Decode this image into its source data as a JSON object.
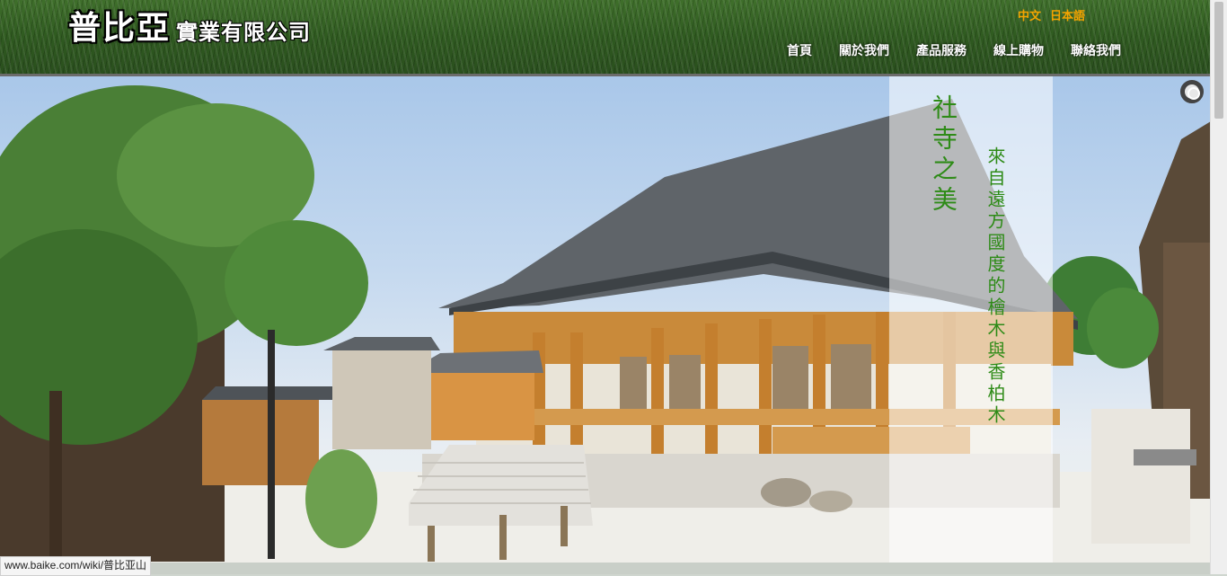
{
  "brand": {
    "name_big": "普比亞",
    "name_small": "實業有限公司"
  },
  "languages": [
    "中文",
    "日本語"
  ],
  "nav": [
    "首頁",
    "關於我們",
    "產品服務",
    "線上購物",
    "聯絡我們"
  ],
  "banner": {
    "title": "社寺之美",
    "subtitle": "來自遠方國度的檜木與香柏木"
  },
  "status_url": "www.baike.com/wiki/普比亚山",
  "icons": {
    "loader": "loading-ring-icon"
  },
  "colors": {
    "accent_green": "#2e8b17",
    "lang_orange": "#f5a400"
  }
}
